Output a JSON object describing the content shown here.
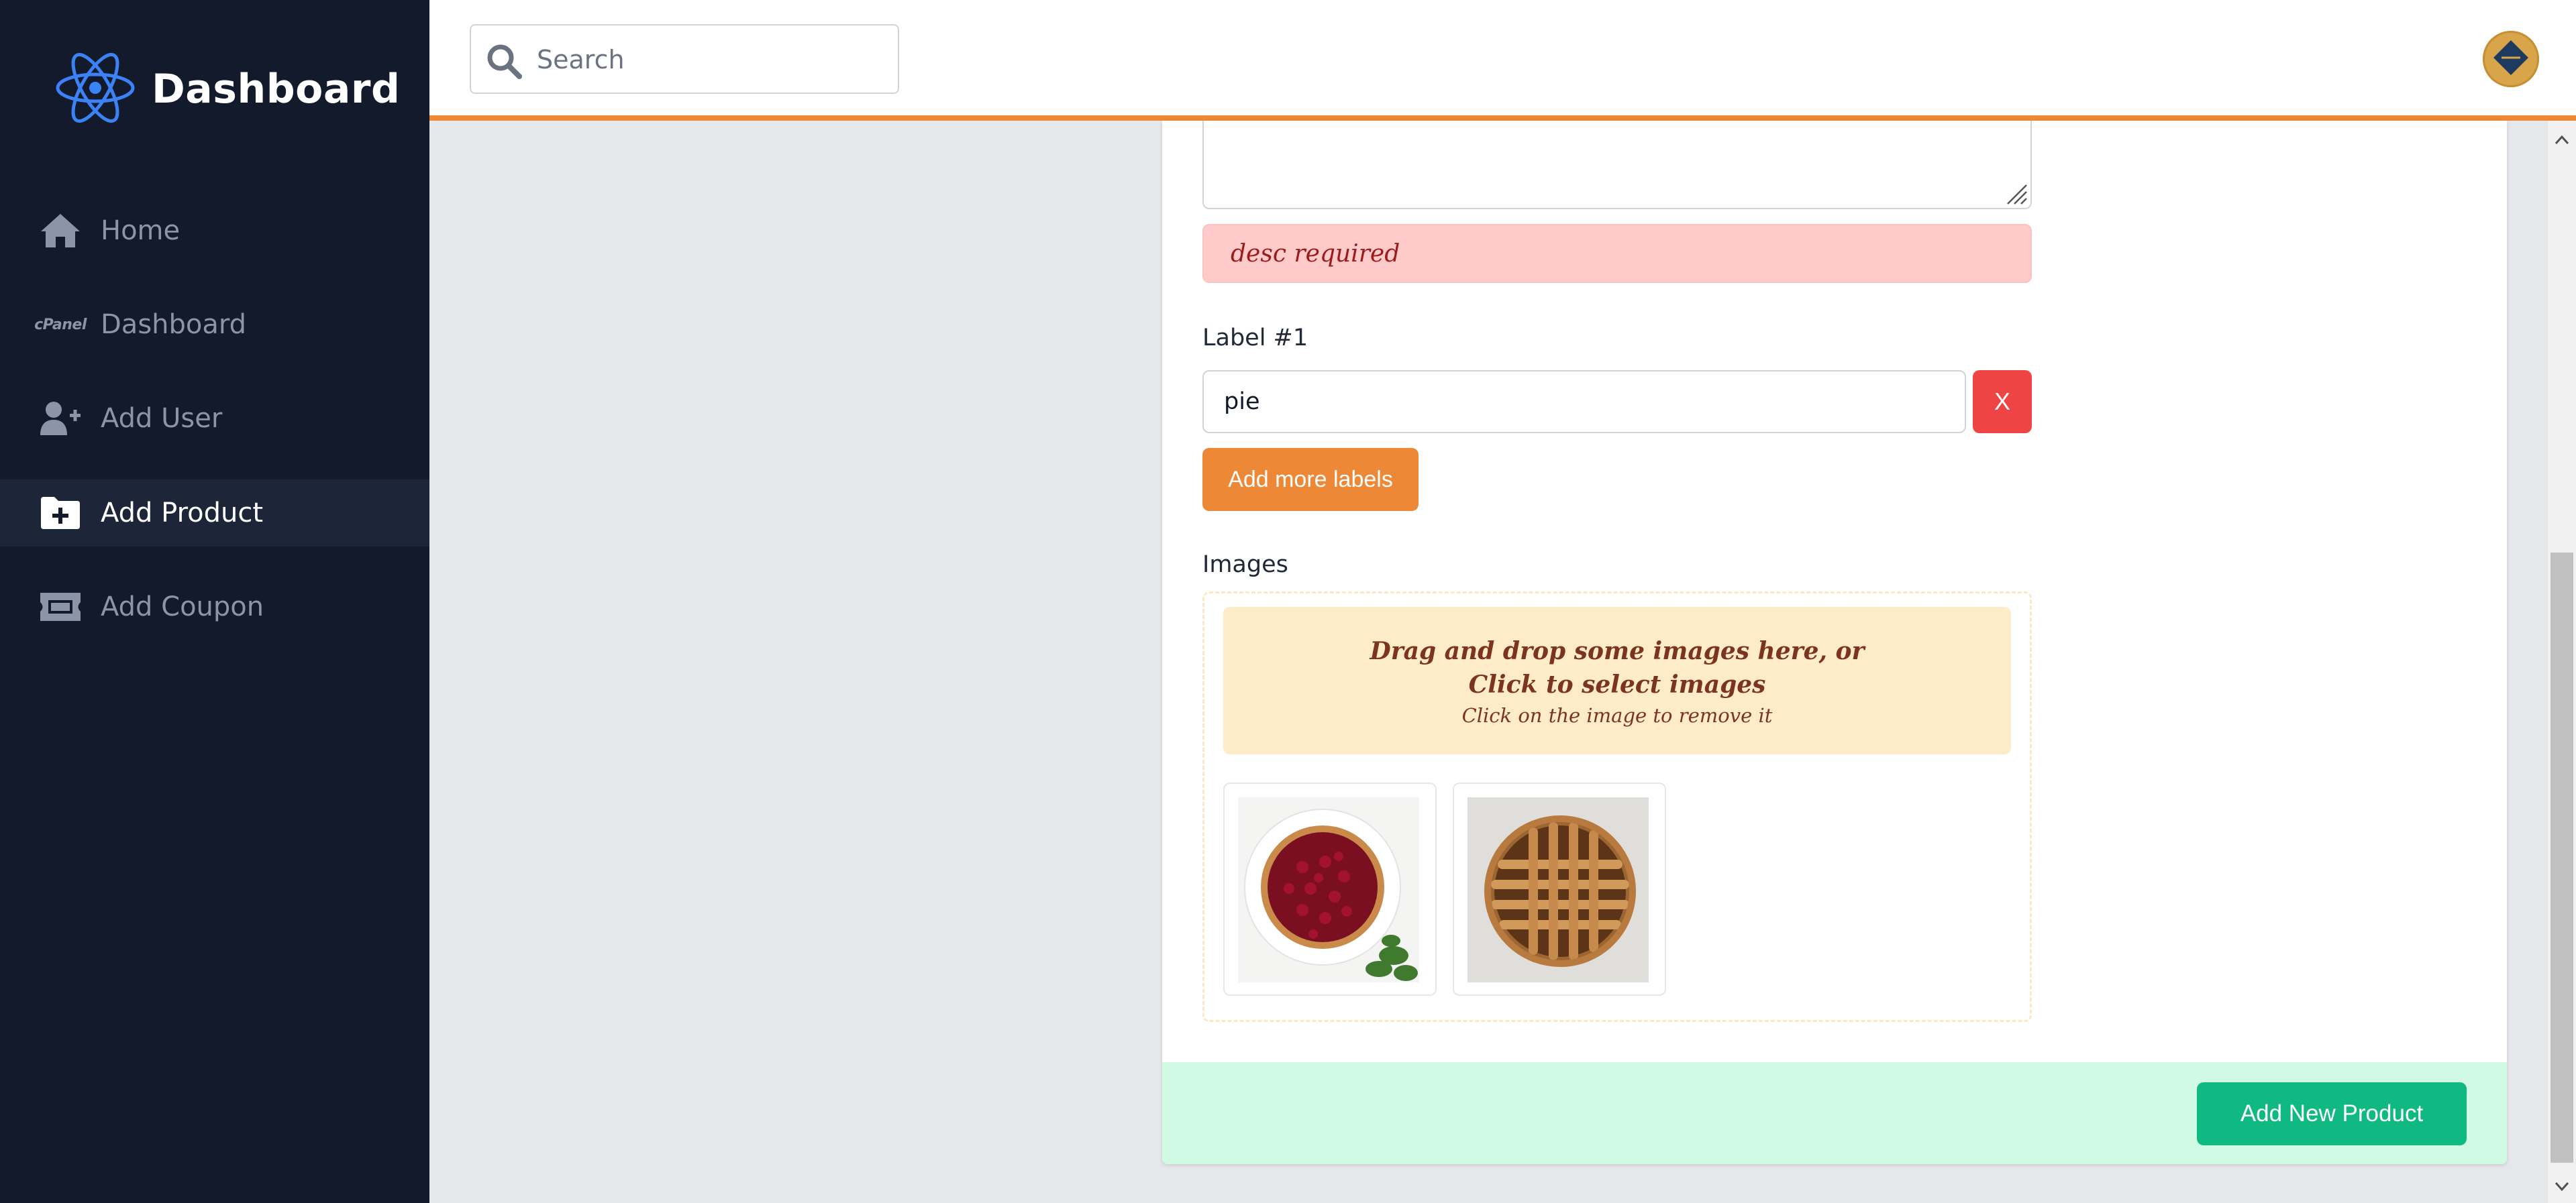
{
  "brand": {
    "title": "Dashboard",
    "logo": "react-atom-icon"
  },
  "sidebar": {
    "items": [
      {
        "label": "Home",
        "icon": "home-icon",
        "active": false
      },
      {
        "label": "Dashboard",
        "icon": "cpanel-icon",
        "icon_text": "cPanel",
        "active": false
      },
      {
        "label": "Add User",
        "icon": "user-plus-icon",
        "active": false
      },
      {
        "label": "Add Product",
        "icon": "folder-plus-icon",
        "active": true
      },
      {
        "label": "Add Coupon",
        "icon": "ticket-icon",
        "active": false
      }
    ]
  },
  "topbar": {
    "search": {
      "placeholder": "Search",
      "value": ""
    },
    "avatar": "avatar-icon"
  },
  "form": {
    "description_error": "desc required",
    "label_field": {
      "label": "Label #1",
      "value": "pie",
      "remove_label": "X"
    },
    "add_labels_button": "Add more labels",
    "images": {
      "label": "Images",
      "dropzone_line1": "Drag and drop some images here, or",
      "dropzone_line2": "Click to select images",
      "dropzone_hint": "Click on the image to remove it",
      "thumbnails": [
        "cherry-pie-image",
        "lattice-pie-image"
      ]
    },
    "submit_button": "Add New Product"
  },
  "colors": {
    "sidebar_bg": "#121a2c",
    "accent_orange": "#ed8936",
    "error_bg": "#fecaca",
    "danger": "#ef4444",
    "dropzone_bg": "#feebc8",
    "footer_bg": "#d1fae5",
    "success": "#10b981"
  }
}
